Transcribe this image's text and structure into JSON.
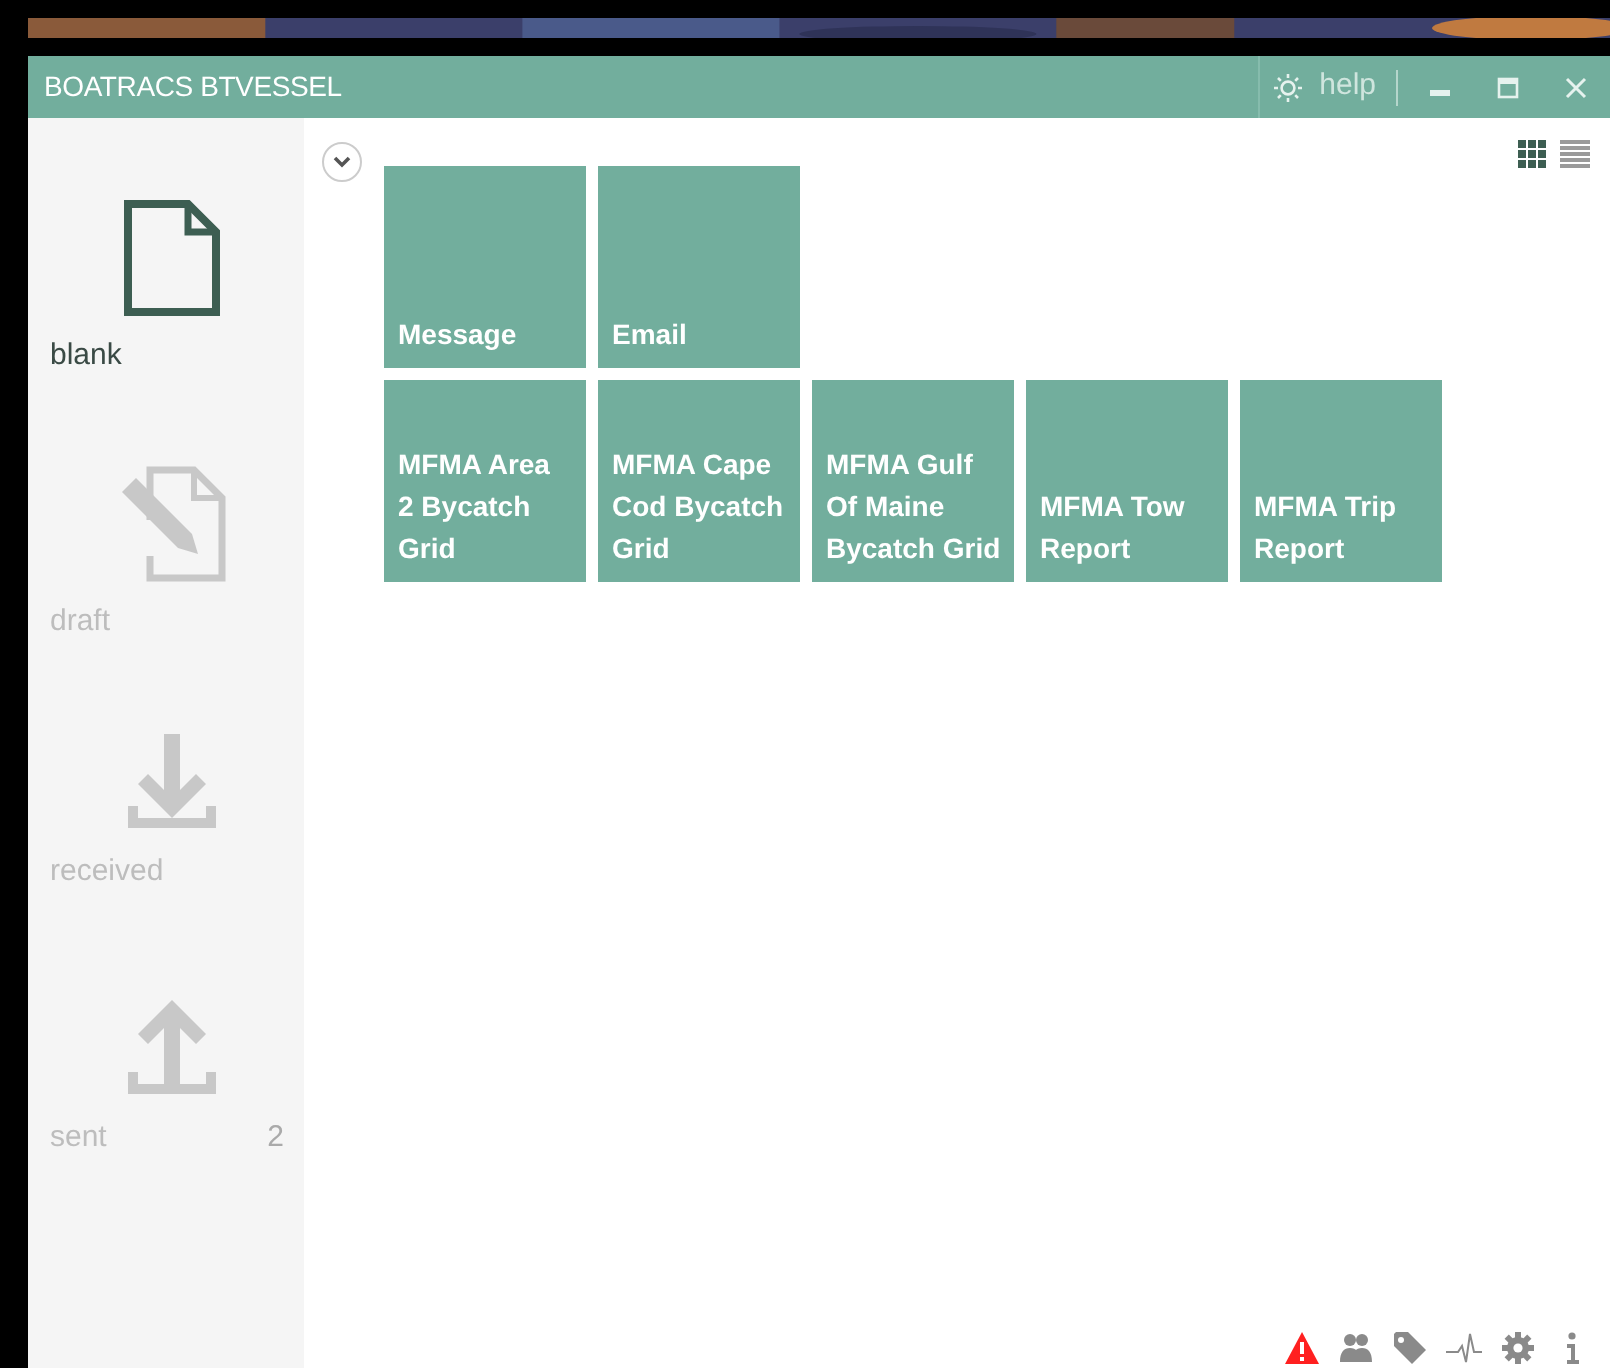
{
  "window": {
    "title": "BOATRACS BTVESSEL",
    "help": "help"
  },
  "sidebar": {
    "items": [
      {
        "kind": "blank",
        "label": "blank",
        "selected": true
      },
      {
        "kind": "draft",
        "label": "draft",
        "selected": false
      },
      {
        "kind": "received",
        "label": "received",
        "selected": false
      },
      {
        "kind": "sent",
        "label": "sent",
        "selected": false,
        "count": "2"
      }
    ]
  },
  "view_modes": [
    {
      "kind": "grid",
      "selected": true
    },
    {
      "kind": "list",
      "selected": false
    }
  ],
  "tile_rows": [
    [
      {
        "lines": [
          "Message"
        ]
      },
      {
        "lines": [
          "Email"
        ]
      }
    ],
    [
      {
        "lines": [
          "MFMA Area",
          "2 Bycatch",
          "Grid"
        ]
      },
      {
        "lines": [
          "MFMA Cape",
          "Cod Bycatch",
          "Grid"
        ]
      },
      {
        "lines": [
          "MFMA Gulf",
          "Of Maine",
          "Bycatch Grid"
        ]
      },
      {
        "lines": [
          "MFMA Tow",
          "Report"
        ]
      },
      {
        "lines": [
          "MFMA Trip",
          "Report"
        ]
      }
    ]
  ],
  "status_icons": [
    {
      "kind": "warning",
      "color": "#ff2020"
    },
    {
      "kind": "people",
      "color": "#8a8a8a"
    },
    {
      "kind": "tag",
      "color": "#8a8a8a"
    },
    {
      "kind": "pulse",
      "color": "#8a8a8a"
    },
    {
      "kind": "gear",
      "color": "#8a8a8a"
    },
    {
      "kind": "info",
      "color": "#8a8a8a"
    }
  ]
}
